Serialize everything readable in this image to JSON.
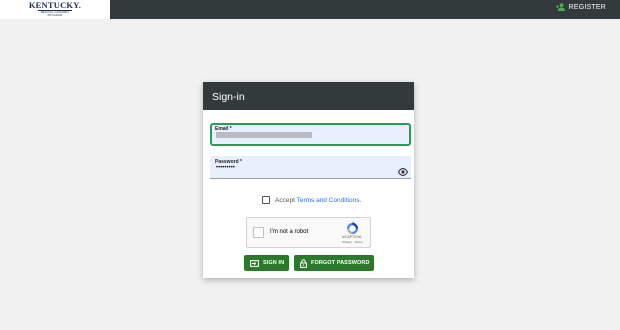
{
  "header": {
    "logo": {
      "main": "KENTUCKY.",
      "sub_line1": "MEDICAL CANNABIS",
      "sub_line2": "PROGRAM"
    },
    "register_label": "REGISTER",
    "register_icon": "person-add-icon"
  },
  "signin_card": {
    "title": "Sign-in",
    "email": {
      "label": "Email *",
      "value": "",
      "value_redacted": true
    },
    "password": {
      "label": "Password *",
      "value": "•••••••••",
      "toggle_icon": "eye-icon"
    },
    "terms": {
      "prefix": "Accept",
      "link": "Terms and Conditions",
      "suffix": ".",
      "checked": false
    },
    "captcha": {
      "label": "I'm not a robot",
      "brand": "reCAPTCHA",
      "links": "Privacy - Terms",
      "icon": "recaptcha-logo-icon"
    },
    "buttons": {
      "signin": {
        "label": "SIGN IN",
        "icon": "login-icon"
      },
      "forgot": {
        "label": "FORGOT PASSWORD",
        "icon": "lock-icon"
      }
    }
  },
  "colors": {
    "header_bg": "#323a3c",
    "page_bg": "#f1f1f1",
    "button_green": "#2b7a2b",
    "focus_green": "#2e9b55",
    "link_blue": "#2d6ee0",
    "field_bg": "#e8f0fe"
  }
}
